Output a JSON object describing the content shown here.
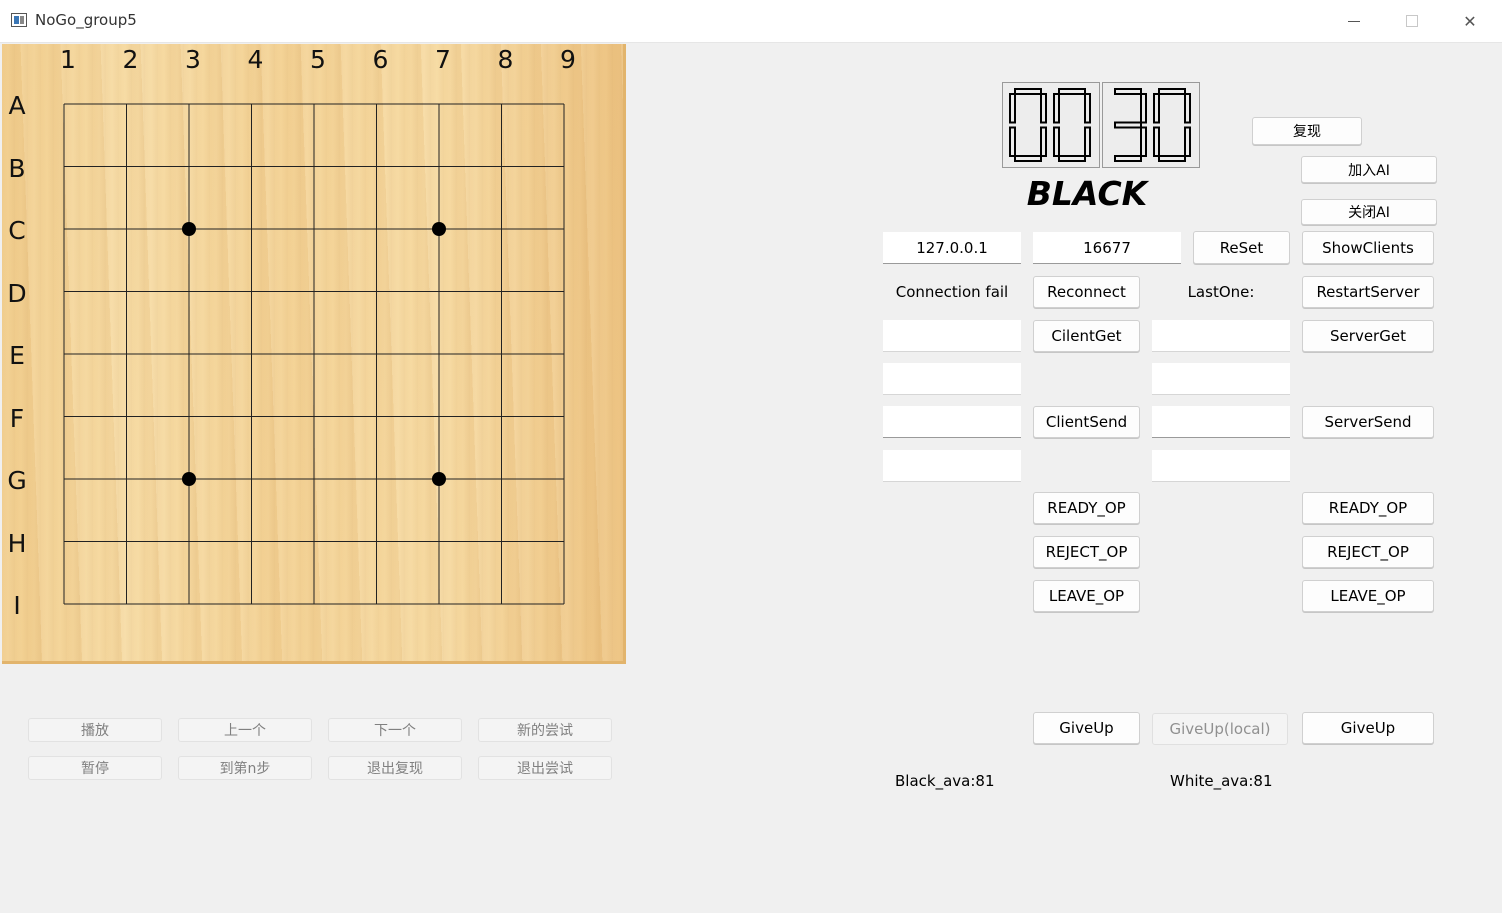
{
  "window": {
    "title": "NoGo_group5",
    "minimize_icon": "minimize-icon",
    "maximize_icon": "maximize-icon",
    "close_icon": "close-icon",
    "close_glyph": "✕"
  },
  "board": {
    "columns": [
      "1",
      "2",
      "3",
      "4",
      "5",
      "6",
      "7",
      "8",
      "9"
    ],
    "rows": [
      "A",
      "B",
      "C",
      "D",
      "E",
      "F",
      "G",
      "H",
      "I"
    ],
    "star_points": [
      {
        "row": "C",
        "col": 3
      },
      {
        "row": "C",
        "col": 7
      },
      {
        "row": "G",
        "col": 3
      },
      {
        "row": "G",
        "col": 7
      }
    ],
    "wood_color": "#f4d396",
    "line_color": "#222222"
  },
  "timer": {
    "minutes": "00",
    "seconds": "30"
  },
  "turn": "BLACK",
  "buttons": {
    "replay": "复现",
    "join_ai": "加入AI",
    "close_ai": "关闭AI",
    "reset": "ReSet",
    "show_clients": "ShowClients",
    "reconnect": "Reconnect",
    "restart_server": "RestartServer",
    "client_get": "CilentGet",
    "server_get": "ServerGet",
    "client_send": "ClientSend",
    "server_send": "ServerSend",
    "client_ready": "READY_OP",
    "server_ready": "READY_OP",
    "client_reject": "REJECT_OP",
    "server_reject": "REJECT_OP",
    "client_leave": "LEAVE_OP",
    "server_leave": "LEAVE_OP",
    "client_giveup": "GiveUp",
    "giveup_local": "GiveUp(local)",
    "server_giveup": "GiveUp"
  },
  "network": {
    "ip": "127.0.0.1",
    "port": "16677",
    "status": "Connection fail",
    "last_one_label": "LastOne:"
  },
  "replay_controls": {
    "play": "播放",
    "prev": "上一个",
    "next": "下一个",
    "new_try": "新的尝试",
    "pause": "暂停",
    "goto_step": "到第n步",
    "exit_replay": "退出复现",
    "exit_try": "退出尝试"
  },
  "stats": {
    "black": "Black_ava:81",
    "white": "White_ava:81"
  }
}
